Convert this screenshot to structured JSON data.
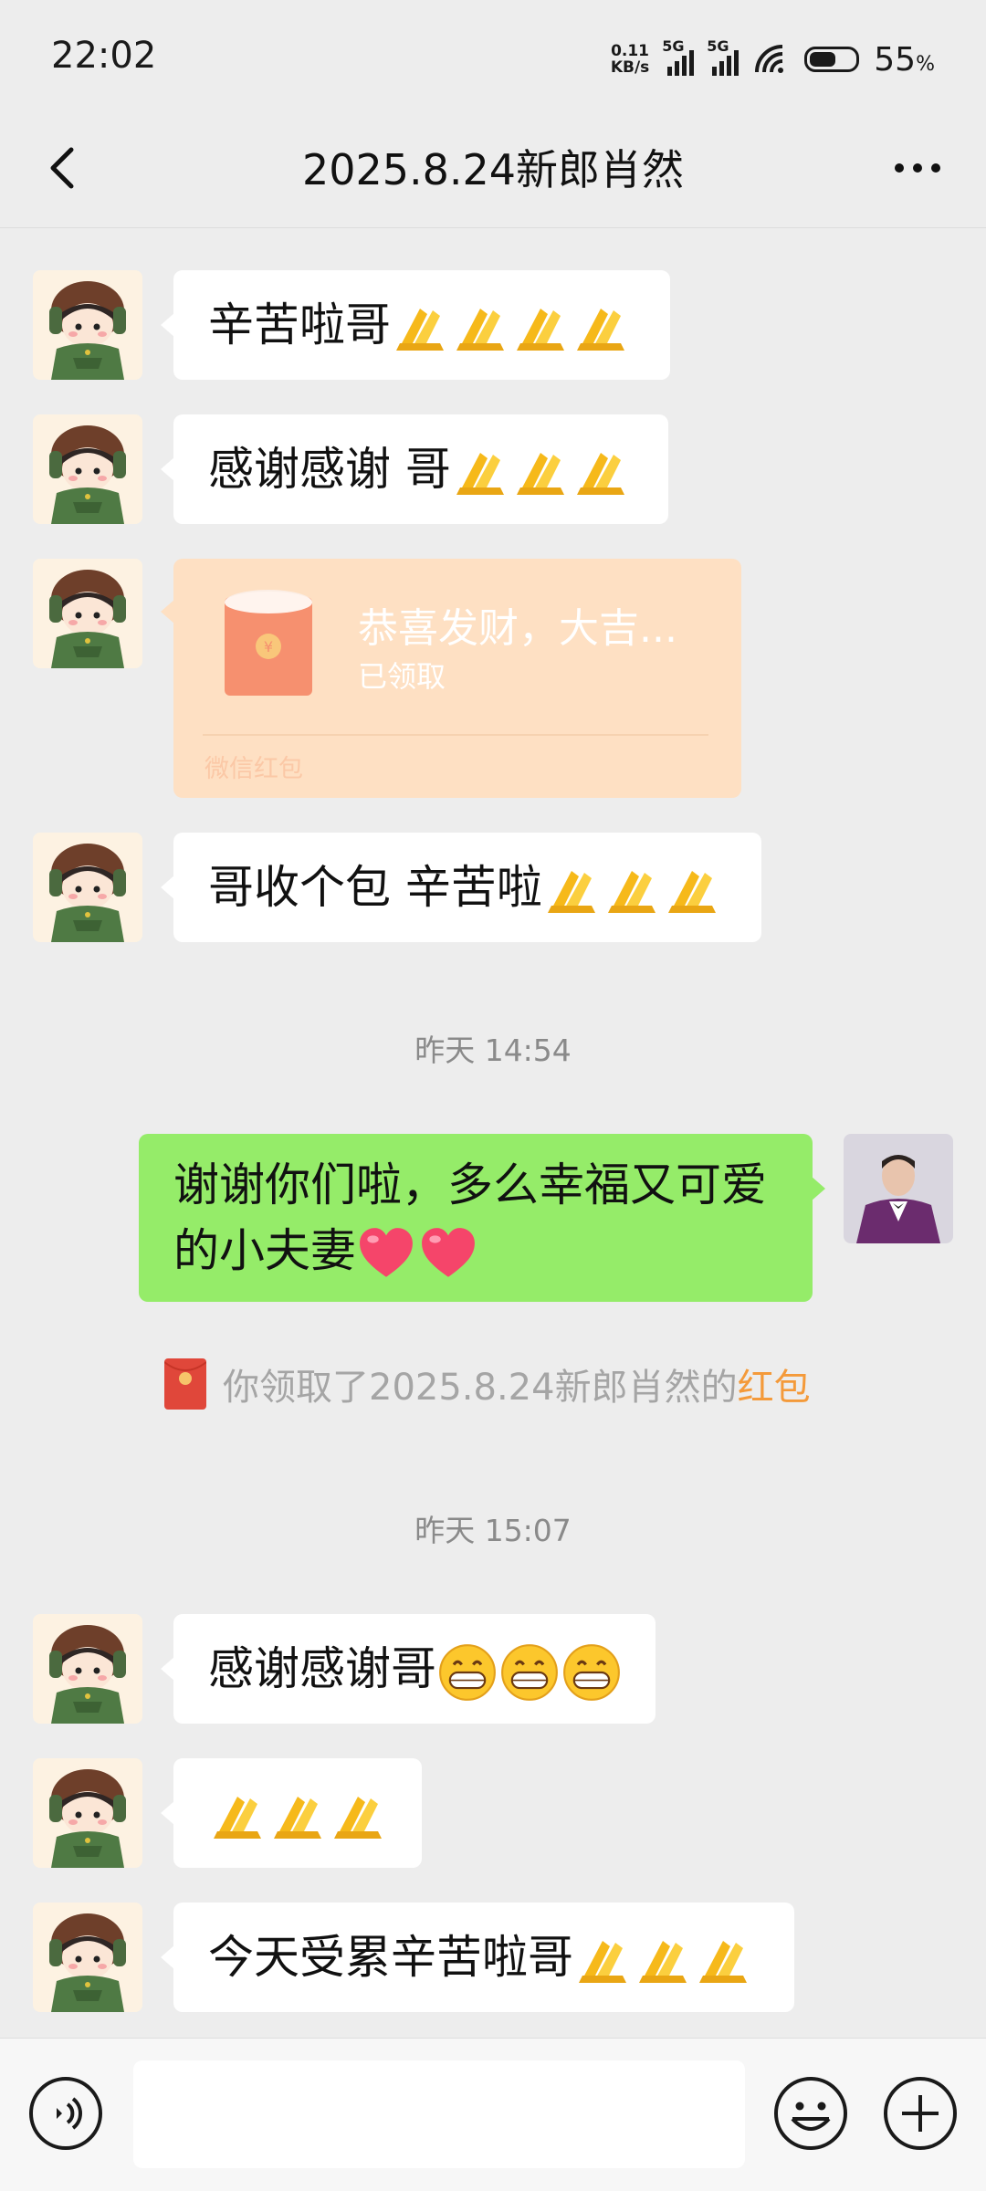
{
  "status": {
    "time": "22:02",
    "net_speed_value": "0.11",
    "net_speed_unit": "KB/s",
    "signal_1": "5G",
    "signal_2": "5G",
    "battery_pct": "55",
    "battery_unit": "%"
  },
  "header": {
    "title": "2025.8.24新郎肖然"
  },
  "messages": [
    {
      "text": "辛苦啦哥"
    },
    {
      "text": "感谢感谢 哥"
    },
    {
      "text": "哥收个包 辛苦啦"
    },
    {
      "text": "谢谢你们啦，多么幸福又可爱的小夫妻"
    },
    {
      "text": "感谢感谢哥"
    },
    {
      "text": "今天受累辛苦啦哥"
    }
  ],
  "red_packet": {
    "title": "恭喜发财，大吉...",
    "status": "已领取",
    "label": "微信红包"
  },
  "timestamps": [
    "昨天 14:54",
    "昨天 15:07"
  ],
  "system_notice": {
    "text": "你领取了2025.8.24新郎肖然的",
    "link": "红包"
  },
  "icons": {
    "back": "back-chevron-icon",
    "more": "more-dots-icon",
    "voice": "voice-icon",
    "emoji": "emoji-icon",
    "plus": "plus-icon",
    "pray_emoji": "folded-hands-emoji",
    "heart_emoji": "heart-emoji",
    "grin_emoji": "grinning-face-emoji"
  },
  "colors": {
    "my_bubble": "#95ec69",
    "red_packet_bg": "#fee0c3",
    "link_orange": "#f49a3a"
  }
}
